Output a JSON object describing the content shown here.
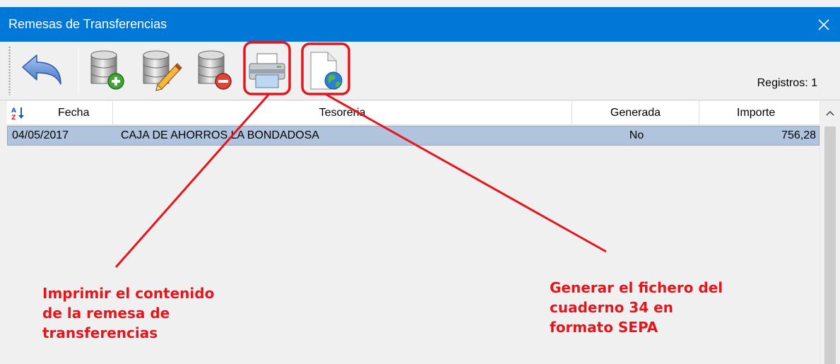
{
  "window": {
    "title": "Remesas de Transferencias",
    "close_symbol": "×",
    "accent_color": "#0078d7"
  },
  "toolbar": {
    "buttons": [
      {
        "name": "back",
        "icon": "undo-arrow-icon"
      },
      {
        "name": "add-record",
        "icon": "database-add-icon"
      },
      {
        "name": "edit-record",
        "icon": "database-edit-icon"
      },
      {
        "name": "delete-record",
        "icon": "database-delete-icon"
      },
      {
        "name": "print",
        "icon": "printer-icon"
      },
      {
        "name": "generate-file",
        "icon": "document-globe-icon"
      }
    ],
    "records_label": "Registros: 1"
  },
  "grid": {
    "sort_icon": "sort-az-icon",
    "columns": [
      "Fecha",
      "Tesoreria",
      "Generada",
      "Importe"
    ],
    "rows": [
      {
        "fecha": "04/05/2017",
        "tesoreria": "CAJA DE AHORROS LA BONDADOSA",
        "generada": "No",
        "importe": "756,28"
      }
    ],
    "selected_row_color": "#b0c4de"
  },
  "scrollbar": {
    "up_arrow": "^"
  },
  "annotations": {
    "color": "#e8141c",
    "print_note": "Imprimir el contenido\nde la remesa de\ntransferencias",
    "sepa_note": "Generar el fichero del\ncuaderno 34 en\nformato SEPA"
  }
}
